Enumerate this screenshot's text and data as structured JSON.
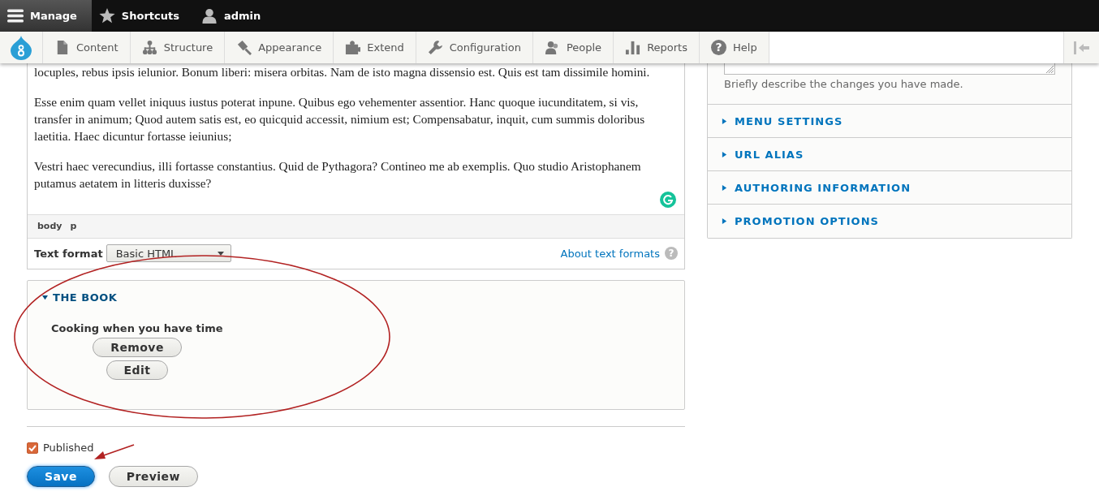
{
  "toolbar": {
    "items": [
      {
        "label": "Manage",
        "selected": true
      },
      {
        "label": "Shortcuts",
        "selected": false
      },
      {
        "label": "admin",
        "selected": false
      }
    ]
  },
  "tray": {
    "items": [
      {
        "label": "Content",
        "selected": false
      },
      {
        "label": "Structure",
        "selected": false
      },
      {
        "label": "Appearance",
        "selected": false
      },
      {
        "label": "Extend",
        "selected": false
      },
      {
        "label": "Configuration",
        "selected": false
      },
      {
        "label": "People",
        "selected": false
      },
      {
        "label": "Reports",
        "selected": false
      },
      {
        "label": "Help",
        "selected": false,
        "glyph": "?"
      }
    ]
  },
  "editor": {
    "paragraphs": [
      "locuples, rebus ipsis ielunior. Bonum liberi: misera orbitas. Nam de isto magna dissensio est. Quis est tam dissimile homini.",
      "Esse enim quam vellet iniquus iustus poterat inpune. Quibus ego vehementer assentior. Hanc quoque iucunditatem, si vis, transfer in animum; Quod autem satis est, eo quicquid accessit, nimium est; Compensabatur, inquit, cum summis doloribus laetitia. Haec dicuntur fortasse ieiunius;",
      "Vestri haec verecundius, illi fortasse constantius. Quid de Pythagora? Contineo me ab exemplis. Quo studio Aristophanem putamus aetatem in litteris duxisse?"
    ],
    "path": [
      "body",
      "p"
    ],
    "text_format": {
      "label": "Text format",
      "value": "Basic HTML"
    },
    "help_link": "About text formats",
    "help_glyph": "?"
  },
  "book": {
    "title": "THE BOOK",
    "expanded": true,
    "book_title": "Cooking when you have time",
    "buttons": [
      "Remove",
      "Edit"
    ]
  },
  "published": {
    "label": "Published",
    "checked": true
  },
  "actions": [
    {
      "label": "Save",
      "kind": "primary"
    },
    {
      "label": "Preview",
      "kind": "secondary"
    }
  ],
  "sidebar": {
    "revision_hint": "Briefly describe the changes you have made.",
    "sections": [
      {
        "title": "MENU SETTINGS",
        "expanded": false
      },
      {
        "title": "URL ALIAS",
        "expanded": false
      },
      {
        "title": "AUTHORING INFORMATION",
        "expanded": false
      },
      {
        "title": "PROMOTION OPTIONS",
        "expanded": false
      }
    ]
  }
}
